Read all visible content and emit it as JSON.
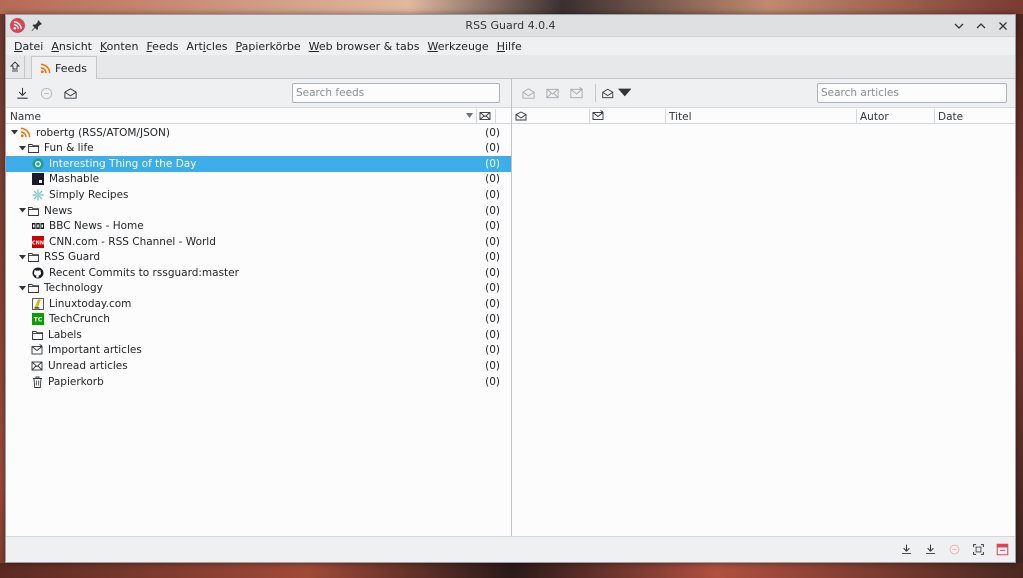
{
  "window": {
    "title": "RSS Guard 4.0.4"
  },
  "menu": [
    {
      "label": "Datei",
      "u": "D",
      "rest": "atei"
    },
    {
      "label": "Ansicht",
      "u": "A",
      "rest": "nsicht"
    },
    {
      "label": "Konten",
      "u": "K",
      "rest": "onten"
    },
    {
      "label": "Feeds",
      "u": "F",
      "rest": "eeds"
    },
    {
      "label": "Articles",
      "pre": "Art",
      "u": "i",
      "rest": "cles"
    },
    {
      "label": "Papierkörbe",
      "u": "P",
      "rest": "apierkörbe"
    },
    {
      "label": "Web browser & tabs",
      "u": "W",
      "rest": "eb browser & tabs"
    },
    {
      "label": "Werkzeuge",
      "u": "W",
      "rest": "erkzeuge"
    },
    {
      "label": "Hilfe",
      "u": "H",
      "rest": "ilfe"
    }
  ],
  "tabs": {
    "feeds_label": "Feeds"
  },
  "feeds": {
    "search_placeholder": "Search feeds",
    "header_name": "Name",
    "tree": [
      {
        "label": "robertg (RSS/ATOM/JSON)",
        "count": "(0)",
        "level": 0,
        "arrow": true,
        "icon": "rss-icon"
      },
      {
        "label": "Fun & life",
        "count": "(0)",
        "level": 1,
        "arrow": true,
        "icon": "folder-icon"
      },
      {
        "label": "Interesting Thing of the Day",
        "count": "(0)",
        "level": 2,
        "icon": "itotd-favicon",
        "selected": true
      },
      {
        "label": "Mashable",
        "count": "(0)",
        "level": 2,
        "icon": "mashable-favicon"
      },
      {
        "label": "Simply Recipes",
        "count": "(0)",
        "level": 2,
        "icon": "simply-recipes-favicon"
      },
      {
        "label": "News",
        "count": "(0)",
        "level": 1,
        "arrow": true,
        "icon": "folder-icon"
      },
      {
        "label": "BBC News - Home",
        "count": "(0)",
        "level": 2,
        "icon": "bbc-favicon"
      },
      {
        "label": "CNN.com - RSS Channel - World",
        "count": "(0)",
        "level": 2,
        "icon": "cnn-favicon"
      },
      {
        "label": "RSS Guard",
        "count": "(0)",
        "level": 1,
        "arrow": true,
        "icon": "folder-icon"
      },
      {
        "label": "Recent Commits to rssguard:master",
        "count": "(0)",
        "level": 2,
        "icon": "github-favicon"
      },
      {
        "label": "Technology",
        "count": "(0)",
        "level": 1,
        "arrow": true,
        "icon": "folder-icon"
      },
      {
        "label": "Linuxtoday.com",
        "count": "(0)",
        "level": 2,
        "icon": "linuxtoday-favicon"
      },
      {
        "label": "TechCrunch",
        "count": "(0)",
        "level": 2,
        "icon": "techcrunch-favicon"
      },
      {
        "label": "Labels",
        "count": "(0)",
        "level": 1,
        "icon": "folder-icon"
      },
      {
        "label": "Important articles",
        "count": "(0)",
        "level": 1,
        "icon": "important-icon"
      },
      {
        "label": "Unread articles",
        "count": "(0)",
        "level": 1,
        "icon": "unread-icon"
      },
      {
        "label": "Papierkorb",
        "count": "(0)",
        "level": 1,
        "icon": "trash-icon"
      }
    ]
  },
  "articles": {
    "search_placeholder": "Search articles",
    "columns": {
      "title": "Titel",
      "author": "Autor",
      "date": "Date"
    }
  },
  "favicon_labels": {
    "cnn": "CNN",
    "techcrunch": "TC"
  },
  "colors": {
    "selection": "#3daee9",
    "rss": "#f67400",
    "cnn": "#cc0000",
    "techcrunch": "#0a9e01",
    "close_red": "#da4453"
  }
}
